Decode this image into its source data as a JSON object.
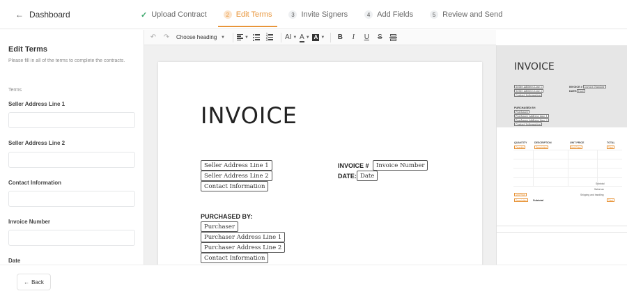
{
  "header": {
    "back_label": "Dashboard",
    "steps": [
      {
        "num": "",
        "label": "Upload Contract",
        "state": "done"
      },
      {
        "num": "2",
        "label": "Edit Terms",
        "state": "active"
      },
      {
        "num": "3",
        "label": "Invite Signers",
        "state": "todo"
      },
      {
        "num": "4",
        "label": "Add Fields",
        "state": "todo"
      },
      {
        "num": "5",
        "label": "Review and Send",
        "state": "todo"
      }
    ]
  },
  "sidebar": {
    "title": "Edit Terms",
    "hint": "Please fill in all of the terms to complete the contracts.",
    "terms_label": "Terms",
    "fields": [
      {
        "label": "Seller Address Line 1",
        "value": ""
      },
      {
        "label": "Seller Address Line 2",
        "value": ""
      },
      {
        "label": "Contact Information",
        "value": ""
      },
      {
        "label": "Invoice Number",
        "value": ""
      },
      {
        "label": "Date",
        "value": ""
      }
    ]
  },
  "toolbar": {
    "heading_select": "Choose heading",
    "font_size": "AI",
    "bold": "B",
    "italic": "I",
    "underline": "U",
    "strike": "S",
    "font_color": "A",
    "bg_color": "A"
  },
  "document": {
    "title": "INVOICE",
    "seller_tokens": [
      "Seller Address Line 1",
      "Seller Address Line 2",
      "Contact Information"
    ],
    "invoice_label": "INVOICE #",
    "invoice_token": "Invoice Number",
    "date_label": "DATE:",
    "date_token": "Date",
    "purchased_label": "PURCHASED BY:",
    "purchaser_tokens": [
      "Purchaser",
      "Purchaser Address Line 1",
      "Purchaser Address Line 2",
      "Contact Information"
    ]
  },
  "preview": {
    "title": "INVOICE",
    "seller_tokens": [
      "Seller Address Line 1",
      "Seller Address Line 2",
      "Contact Information"
    ],
    "invoice_label": "INVOICE #",
    "invoice_token": "Invoice Number",
    "date_label": "DATE:",
    "date_token": "Date",
    "purchased_label": "PURCHASED BY:",
    "purchaser_tokens": [
      "Purchaser",
      "Purchaser Address Line 1",
      "Purchaser Address Line 2",
      "Contact Information"
    ],
    "table_headers": [
      "QUANTITY",
      "DESCRIPTION",
      "UNIT PRICE",
      "TOTAL"
    ],
    "row_tokens": [
      "Quantity",
      "Description",
      "Unit Price",
      "Total"
    ],
    "summary": [
      "Subtotal",
      "Sales tax",
      "Shipping and handling"
    ],
    "subtotal_label": "Subtotal"
  },
  "footer": {
    "back_label": "Back"
  },
  "colors": {
    "accent": "#e8953a",
    "done": "#3aa66b"
  }
}
